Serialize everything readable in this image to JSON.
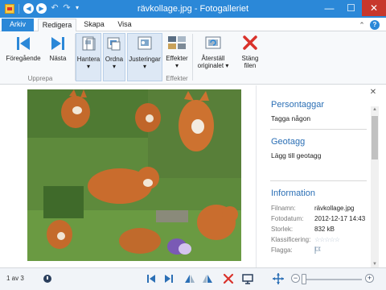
{
  "window": {
    "title": "rävkollage.jpg - Fotogalleriet",
    "minimize_glyph": "—",
    "maximize_glyph": "☐",
    "close_glyph": "✕",
    "help_glyph": "?",
    "accent_color": "#2b88d8",
    "close_color": "#c7372c"
  },
  "quick_access": {
    "back_glyph": "◀",
    "forward_glyph": "▶",
    "undo_glyph": "↶",
    "redo_glyph": "↷",
    "customize_glyph": "▾"
  },
  "ribbon": {
    "tabs": {
      "file": "Arkiv",
      "edit": "Redigera",
      "create": "Skapa",
      "view": "Visa"
    },
    "groups": {
      "navigate": "Upprepa",
      "effects": "Effekter"
    },
    "buttons": {
      "previous": "Föregående",
      "next": "Nästa",
      "manage": "Hantera",
      "organize": "Ordna",
      "adjustments": "Justeringar",
      "effects": "Effekter",
      "revert_line1": "Återställ",
      "revert_line2": "originalet",
      "close_line1": "Stäng",
      "close_line2": "filen"
    }
  },
  "panel": {
    "people_tags_heading": "Persontaggar",
    "tag_someone": "Tagga någon",
    "geotag_heading": "Geotagg",
    "add_geotag": "Lägg till geotagg",
    "info_heading": "Information",
    "fields": {
      "filename_label": "Filnamn:",
      "filename_value": "rävkollage.jpg",
      "date_label": "Fotodatum:",
      "date_value": "2012-12-17   14:43",
      "size_label": "Storlek:",
      "size_value": "832 kB",
      "rating_label": "Klassificering:",
      "rating_value": 0,
      "rating_max": 5,
      "flag_label": "Flagga:"
    }
  },
  "status": {
    "position": "1 av 3",
    "zoom_fraction": 0.0
  },
  "icons": {
    "photo": "fox-collage-image",
    "status_clock": "clock-icon"
  }
}
